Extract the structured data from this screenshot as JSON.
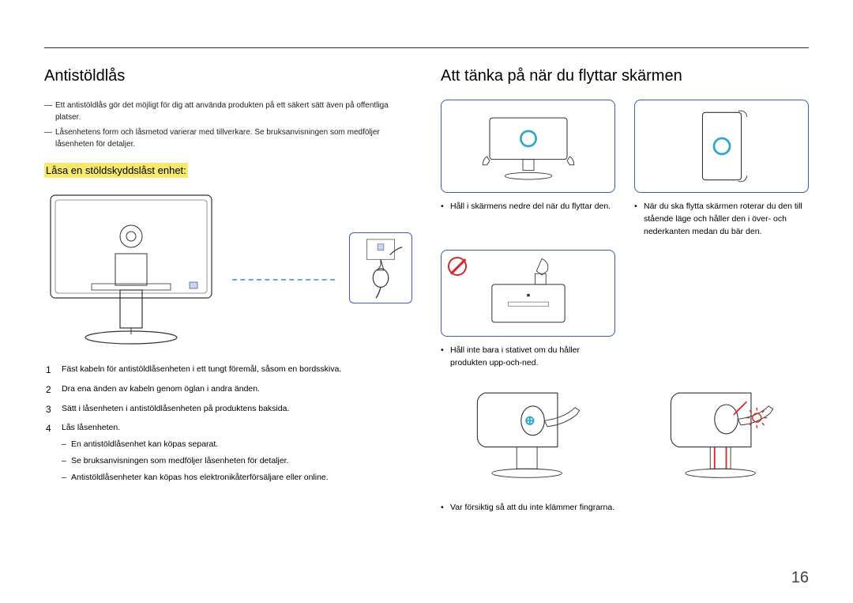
{
  "left": {
    "heading": "Antistöldlås",
    "notes": [
      "Ett antistöldlås gör det möjligt för dig att använda produkten på ett säkert sätt även på offentliga platser.",
      "Låsenhetens form och låsmetod varierar med tillverkare. Se bruksanvisningen som medföljer låsenheten för detaljer."
    ],
    "subheading": "Låsa en stöldskyddslåst enhet:",
    "steps": [
      {
        "text": "Fäst kabeln för antistöldlåsenheten i ett tungt föremål, såsom en bordsskiva."
      },
      {
        "text": "Dra ena änden av kabeln genom öglan i andra änden."
      },
      {
        "text": "Sätt i låsenheten i antistöldlåsenheten på produktens baksida."
      },
      {
        "text": "Lås låsenheten.",
        "sub": [
          "En antistöldlåsenhet kan köpas separat.",
          "Se bruksanvisningen som medföljer låsenheten för detaljer.",
          "Antistöldlåsenheter kan köpas hos elektronikåterförsäljare eller online."
        ]
      }
    ]
  },
  "right": {
    "heading": "Att tänka på när du flyttar skärmen",
    "tile1_caption": "Håll i skärmens nedre del när du flyttar den.",
    "tile2_caption": "När du ska flytta skärmen roterar du den till stående läge och håller den i över- och nederkanten medan du bär den.",
    "tile3_caption": "Håll inte bara i stativet om du håller produkten upp-och-ned.",
    "tile4_caption": "Var försiktig så att du inte klämmer fingrarna."
  },
  "page_number": "16"
}
